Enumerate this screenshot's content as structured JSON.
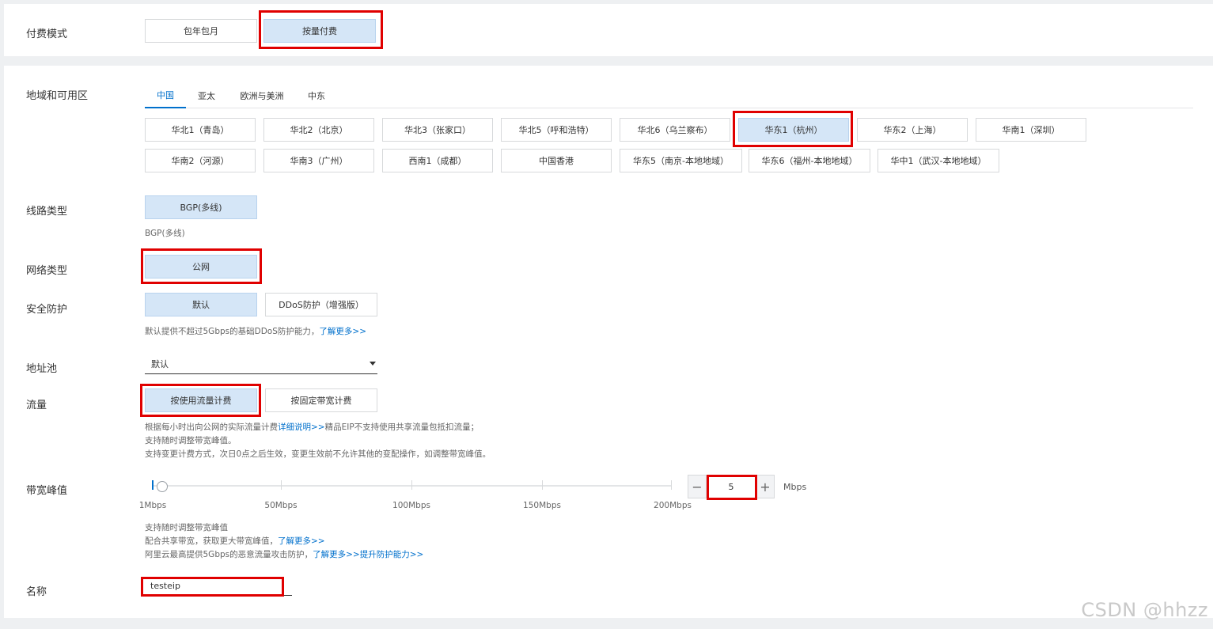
{
  "billing": {
    "label": "付费模式",
    "options": [
      "包年包月",
      "按量付费"
    ],
    "selected_index": 1
  },
  "region": {
    "label": "地域和可用区",
    "tabs": [
      "中国",
      "亚太",
      "欧洲与美洲",
      "中东"
    ],
    "active_tab": 0,
    "options": [
      "华北1（青岛）",
      "华北2（北京）",
      "华北3（张家口）",
      "华北5（呼和浩特）",
      "华北6（乌兰察布）",
      "华东1（杭州）",
      "华东2（上海）",
      "华南1（深圳）",
      "华南2（河源）",
      "华南3（广州）",
      "西南1（成都）",
      "中国香港",
      "华东5（南京-本地地域）",
      "华东6（福州-本地地域）",
      "华中1（武汉-本地地域）"
    ],
    "selected_index": 5
  },
  "line_type": {
    "label": "线路类型",
    "option": "BGP(多线)",
    "hint": "BGP(多线)"
  },
  "network_type": {
    "label": "网络类型",
    "option": "公网"
  },
  "security": {
    "label": "安全防护",
    "options": [
      "默认",
      "DDoS防护（增强版）"
    ],
    "selected_index": 0,
    "hint_text": "默认提供不超过5Gbps的基础DDoS防护能力，",
    "hint_link": "了解更多>>"
  },
  "address_pool": {
    "label": "地址池",
    "value": "默认"
  },
  "traffic": {
    "label": "流量",
    "options": [
      "按使用流量计费",
      "按固定带宽计费"
    ],
    "selected_index": 0,
    "hint1_text": "根据每小时出向公网的实际流量计费",
    "hint1_link": "详细说明>>",
    "hint1_tail": "精品EIP不支持使用共享流量包抵扣流量；",
    "hint2": "支持随时调整带宽峰值。",
    "hint3": "支持变更计费方式，次日0点之后生效，变更生效前不允许其他的变配操作，如调整带宽峰值。"
  },
  "bandwidth": {
    "label": "带宽峰值",
    "ticks": [
      "1Mbps",
      "50Mbps",
      "100Mbps",
      "150Mbps",
      "200Mbps"
    ],
    "value": "5",
    "minus": "−",
    "plus": "+",
    "unit": "Mbps",
    "hint1": "支持随时调整带宽峰值",
    "hint2_text": "配合共享带宽，获取更大带宽峰值，",
    "hint2_link": "了解更多>>",
    "hint3_text": "阿里云最高提供5Gbps的恶意流量攻击防护，",
    "hint3_link": "了解更多>>提升防护能力>>"
  },
  "name": {
    "label": "名称",
    "value": "testeip"
  },
  "watermark": "CSDN @hhzz"
}
